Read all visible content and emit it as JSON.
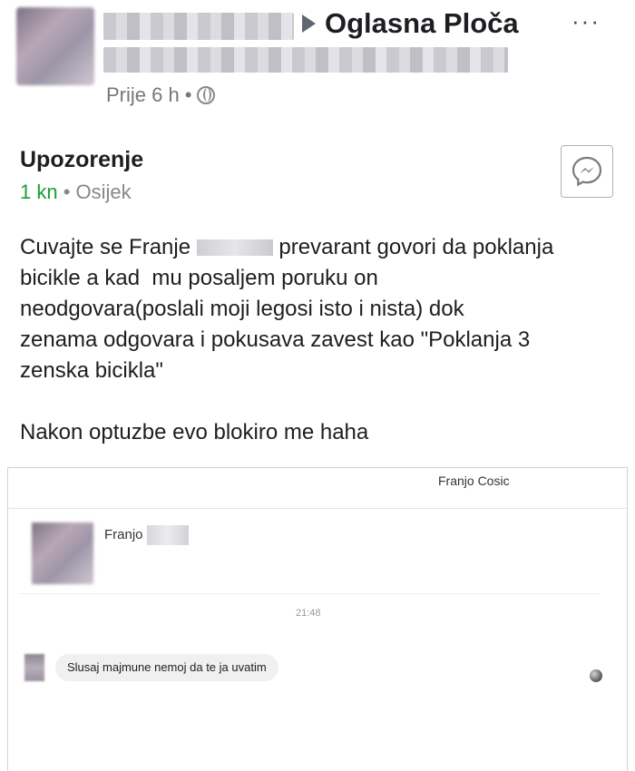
{
  "header": {
    "group_name": "Oglasna Ploča",
    "time": "Prije 6 h",
    "separator": "•",
    "more": "···"
  },
  "listing": {
    "title": "Upozorenje",
    "price": "1 kn",
    "location": "Osijek",
    "dot": "•"
  },
  "post": {
    "line1_before": "Cuvajte se Franje ",
    "line1_after": " prevarant govori da poklanja",
    "rest": "bicikle a kad  mu posaljem poruku on\nneodgovara(poslali moji legosi isto i nista) dok\nzenama odgovara i pokusava zavest kao \"Poklanja 3\nzenska bicikla\"\n\nNakon optuzbe evo blokiro me haha"
  },
  "screenshot": {
    "contact_header": "Franjo Cosic",
    "contact_name": "Franjo",
    "time": "21:48",
    "message": "Slusaj majmune nemoj da te ja uvatim"
  },
  "colors": {
    "price": "#1a9c33",
    "meta": "#777777",
    "text": "#1c1e21"
  }
}
